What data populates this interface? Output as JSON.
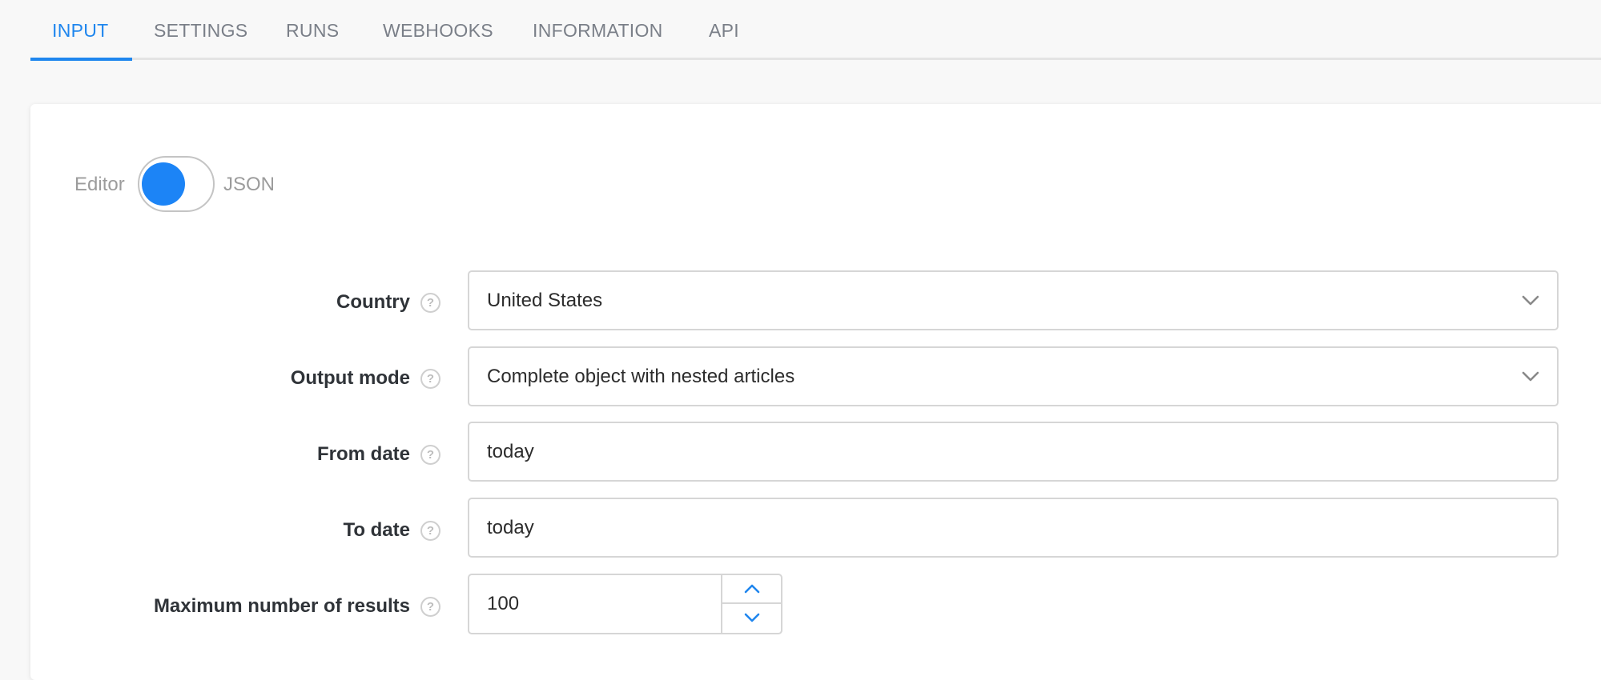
{
  "tabs": [
    {
      "label": "INPUT",
      "active": true
    },
    {
      "label": "SETTINGS",
      "active": false
    },
    {
      "label": "RUNS",
      "active": false
    },
    {
      "label": "WEBHOOKS",
      "active": false
    },
    {
      "label": "INFORMATION",
      "active": false
    },
    {
      "label": "API",
      "active": false
    }
  ],
  "mode_toggle": {
    "left_label": "Editor",
    "right_label": "JSON",
    "selected": "Editor"
  },
  "form": {
    "country": {
      "label": "Country",
      "value": "United States",
      "type": "select"
    },
    "output_mode": {
      "label": "Output mode",
      "value": "Complete object with nested articles",
      "type": "select"
    },
    "from_date": {
      "label": "From date",
      "value": "today",
      "type": "text"
    },
    "to_date": {
      "label": "To date",
      "value": "today",
      "type": "text"
    },
    "max_results": {
      "label": "Maximum number of results",
      "value": "100",
      "type": "number"
    }
  },
  "help_glyph": "?",
  "colors": {
    "accent": "#1f86ee",
    "toggle_knob": "#1c84f6",
    "tab_inactive": "#7a7f88"
  },
  "icons": {
    "help": "help-circle-icon",
    "dropdown": "chevron-down-icon",
    "step_up": "chevron-up-icon",
    "step_down": "chevron-down-icon"
  }
}
